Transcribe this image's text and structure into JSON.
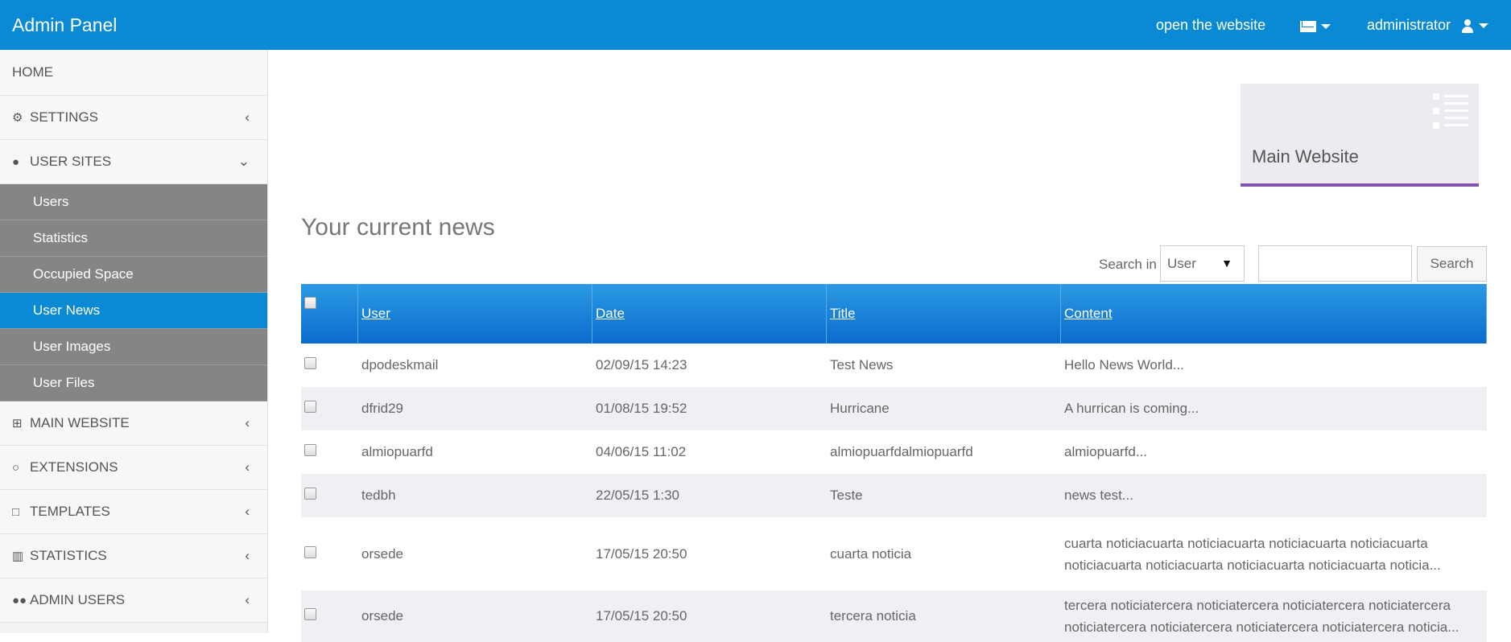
{
  "header": {
    "brand": "Admin Panel",
    "open_website": "open the website",
    "user_name": "administrator"
  },
  "sidebar": {
    "items": [
      {
        "label": "HOME",
        "icon": ""
      },
      {
        "label": "SETTINGS",
        "icon": "gears-icon",
        "chevron": "‹"
      },
      {
        "label": "USER SITES",
        "icon": "user-icon",
        "chevron": "⌄"
      }
    ],
    "sub_items": [
      {
        "label": "Users"
      },
      {
        "label": "Statistics"
      },
      {
        "label": "Occupied Space"
      },
      {
        "label": "User News",
        "active": true
      },
      {
        "label": "User Images"
      },
      {
        "label": "User Files"
      }
    ],
    "items_after": [
      {
        "label": "MAIN WEBSITE",
        "icon": "sitemap-icon",
        "chevron": "‹"
      },
      {
        "label": "EXTENSIONS",
        "icon": "gear-icon",
        "chevron": "‹"
      },
      {
        "label": "TEMPLATES",
        "icon": "square-icon",
        "chevron": "‹"
      },
      {
        "label": "STATISTICS",
        "icon": "bar-chart-icon",
        "chevron": "‹"
      },
      {
        "label": "ADMIN USERS",
        "icon": "users-icon",
        "chevron": "‹"
      }
    ]
  },
  "card": {
    "title": "Main Website",
    "accent": "#8354ad"
  },
  "main": {
    "title": "Your current news"
  },
  "search": {
    "label": "Search in",
    "selected": "User",
    "value": "",
    "button": "Search"
  },
  "table": {
    "columns": [
      "User",
      "Date",
      "Title",
      "Content"
    ],
    "rows": [
      {
        "user": "dpodeskmail",
        "date": "02/09/15 14:23",
        "title": "Test News",
        "content": "Hello News World..."
      },
      {
        "user": "dfrid29",
        "date": "01/08/15 19:52",
        "title": "Hurricane",
        "content": "A hurrican is coming..."
      },
      {
        "user": "almiopuarfd",
        "date": "04/06/15 11:02",
        "title": "almiopuarfdalmiopuarfd",
        "content": "almiopuarfd..."
      },
      {
        "user": "tedbh",
        "date": "22/05/15 1:30",
        "title": "Teste",
        "content": "news test..."
      },
      {
        "user": "orsede",
        "date": "17/05/15 20:50",
        "title": "cuarta noticia",
        "content": "cuarta noticiacuarta noticiacuarta noticiacuarta noticiacuarta noticiacuarta noticiacuarta noticiacuarta noticiacuarta noticia..."
      },
      {
        "user": "orsede",
        "date": "17/05/15 20:50",
        "title": "tercera noticia",
        "content": "tercera noticiatercera noticiatercera noticiatercera noticiatercera noticiatercera noticiatercera noticiatercera noticiatercera noticia..."
      }
    ]
  },
  "colors": {
    "primary": "#0a8ad4",
    "sidebar_sub": "#858585"
  }
}
